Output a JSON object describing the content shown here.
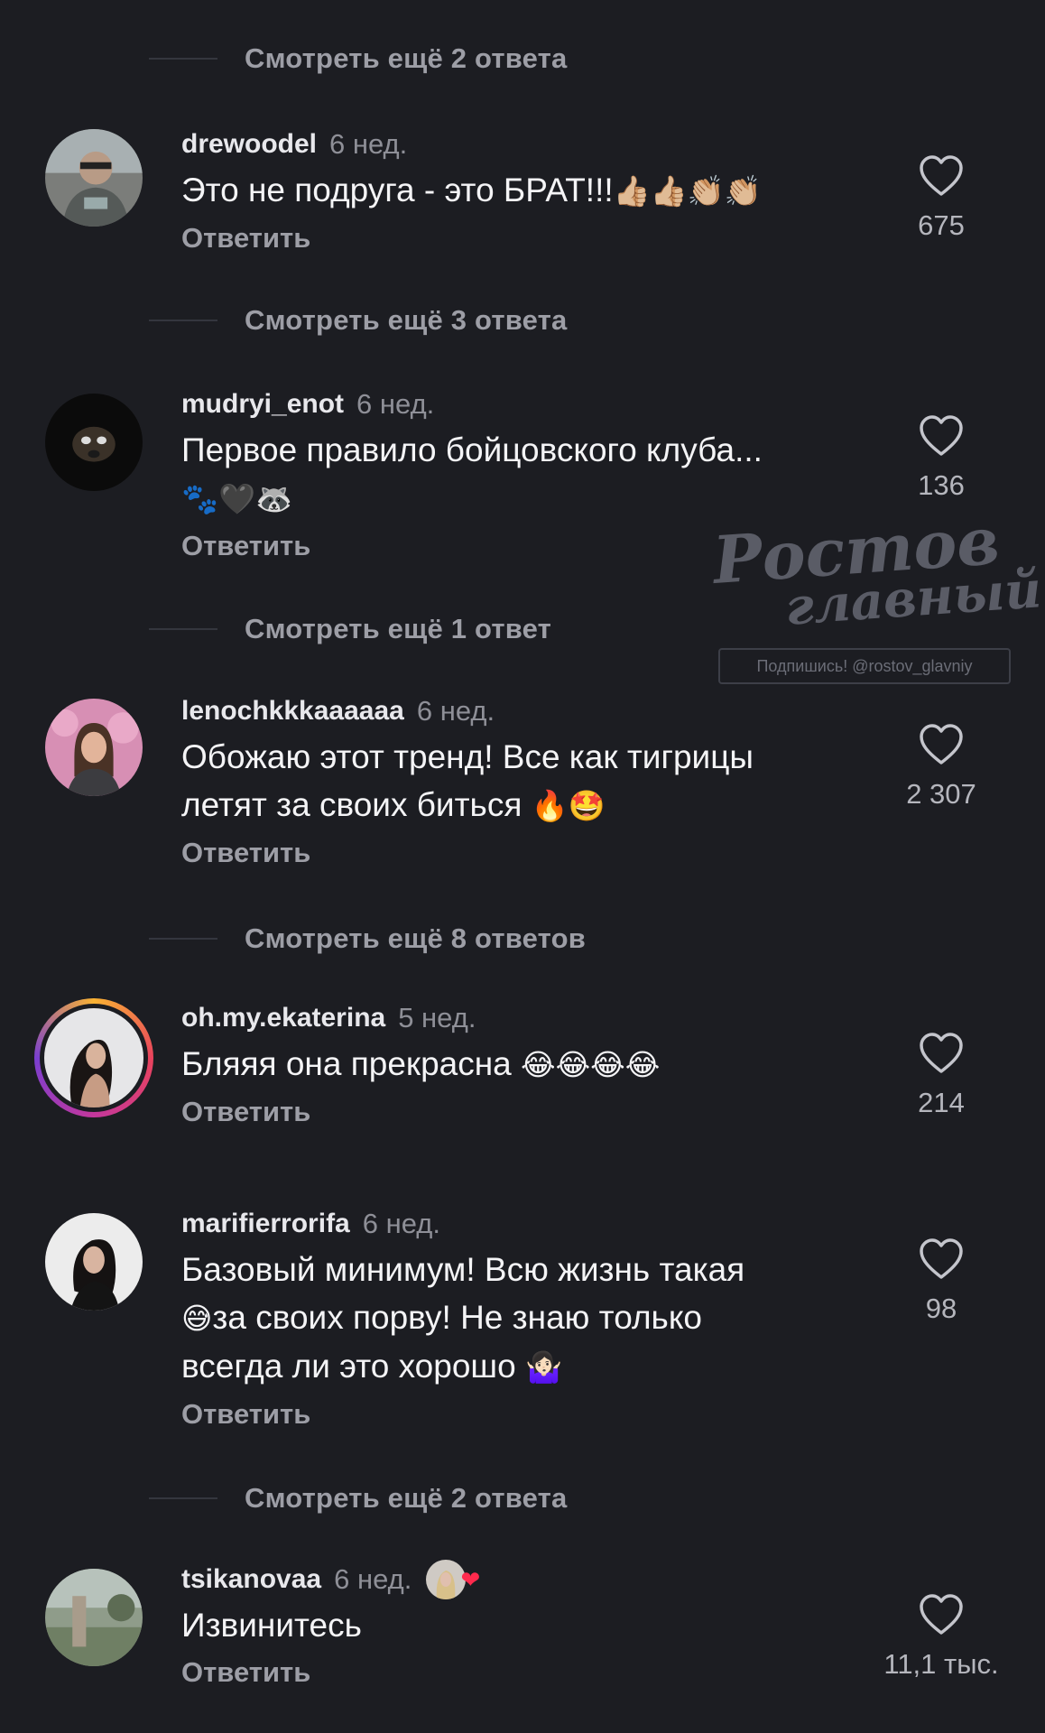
{
  "more_replies": [
    "Смотреть ещё 2 ответа",
    "Смотреть ещё 3 ответа",
    "Смотреть ещё 1 ответ",
    "Смотреть ещё 8 ответов",
    "Смотреть ещё 2 ответа"
  ],
  "reply_label": "Ответить",
  "comments": [
    {
      "username": "drewoodel",
      "time": "6 нед.",
      "text_lines": [
        "Это не подруга - это БРАТ!!!"
      ],
      "emoji": "👍🏼👍🏼👏🏼👏🏼",
      "likes": "675"
    },
    {
      "username": "mudryi_enot",
      "time": "6 нед.",
      "text_lines": [
        "Первое правило бойцовского клуба..."
      ],
      "emoji": "🐾🖤🦝",
      "likes": "136"
    },
    {
      "username": "lenochkkkaaaaaa",
      "time": "6 нед.",
      "text_lines": [
        "Обожаю этот тренд! Все как тигрицы",
        "летят за своих биться"
      ],
      "emoji": "🔥🤩",
      "likes": "2 307"
    },
    {
      "username": "oh.my.ekaterina",
      "time": "5 нед.",
      "text_lines": [
        "Бляяя она прекрасна"
      ],
      "emoji": "😂😂😂😂",
      "likes": "214"
    },
    {
      "username": "marifierrorifa",
      "time": "6 нед.",
      "text_lines": [
        "Базовый минимум! Всю жизнь такая",
        "за своих порву! Не знаю только",
        "всегда ли это хорошо"
      ],
      "emoji_lead": "😅",
      "emoji": "🤷🏻‍♀️",
      "likes": "98"
    },
    {
      "username": "tsikanovaa",
      "time": "6 нед.",
      "text_lines": [
        "Извинитесь"
      ],
      "liked_by_creator": "❤",
      "likes": "11,1 тыс."
    }
  ],
  "watermark": {
    "title": "Ростов",
    "subtitle": "главный",
    "tag": "Подпишись! @rostov_glavniy"
  },
  "icons": {
    "like": "heart-outline-icon"
  }
}
